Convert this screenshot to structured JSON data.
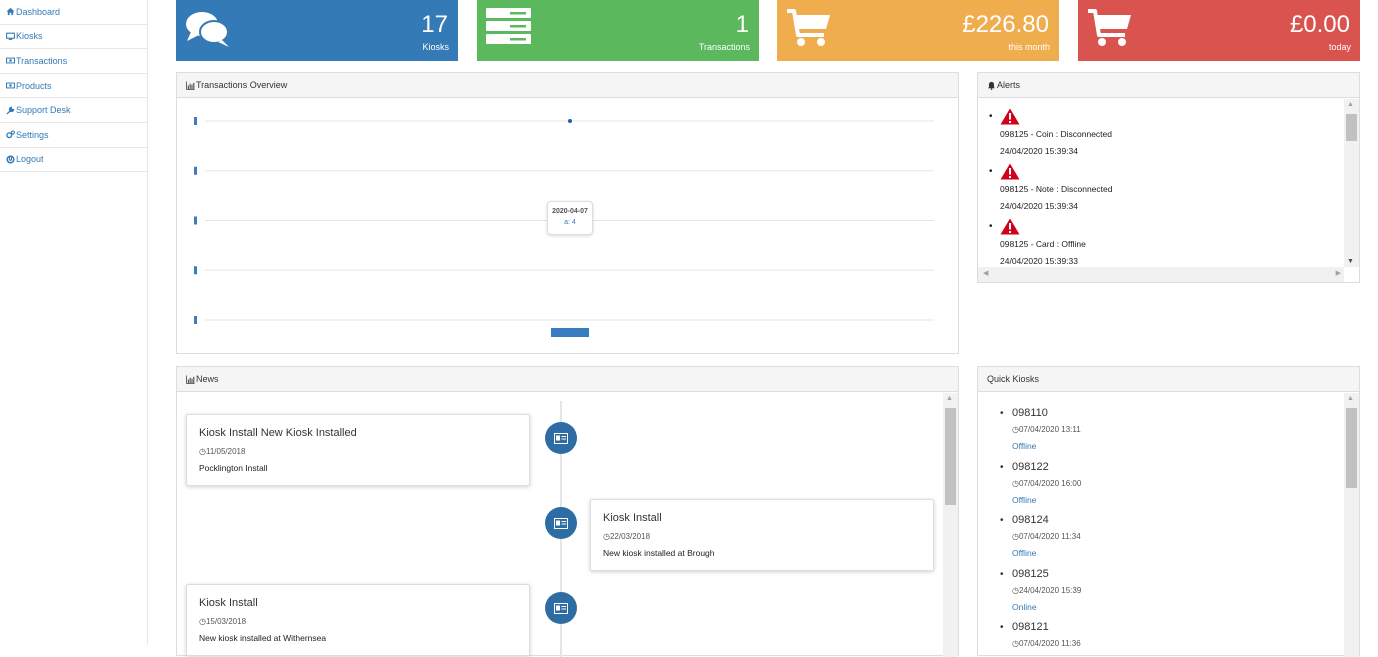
{
  "sidebar": {
    "items": [
      {
        "label": "Dashboard",
        "icon": "home-icon"
      },
      {
        "label": "Kiosks",
        "icon": "desktop-icon"
      },
      {
        "label": "Transactions",
        "icon": "money-icon"
      },
      {
        "label": "Products",
        "icon": "money-icon"
      },
      {
        "label": "Support Desk",
        "icon": "wrench-icon"
      },
      {
        "label": "Settings",
        "icon": "gears-icon"
      },
      {
        "label": "Logout",
        "icon": "power-icon"
      }
    ]
  },
  "stats": [
    {
      "value": "17",
      "label": "Kiosks",
      "color": "#337ab7",
      "icon": "comments-icon"
    },
    {
      "value": "1",
      "label": "Transactions",
      "color": "#5cb85c",
      "icon": "server-icon"
    },
    {
      "value": "£226.80",
      "label": "this month",
      "color": "#f0ad4e",
      "icon": "cart-icon"
    },
    {
      "value": "£0.00",
      "label": "today",
      "color": "#d9534f",
      "icon": "cart-icon"
    }
  ],
  "transactions_panel": {
    "title": "Transactions Overview",
    "tooltip_date": "2020-04-07",
    "tooltip_value": "a: 4"
  },
  "chart_data": {
    "type": "bar",
    "categories": [
      "2020-04-07"
    ],
    "series": [
      {
        "values": [
          4
        ]
      }
    ],
    "grid": true
  },
  "alerts_panel": {
    "title": "Alerts",
    "items": [
      {
        "message": "098125 - Coin : Disconnected",
        "time": "24/04/2020 15:39:34"
      },
      {
        "message": "098125 - Note : Disconnected",
        "time": "24/04/2020 15:39:34"
      },
      {
        "message": "098125 - Card : Offline",
        "time": "24/04/2020 15:39:33"
      }
    ]
  },
  "news_panel": {
    "title": "News",
    "items": [
      {
        "title": "Kiosk Install New Kiosk Installed",
        "date": "11/05/2018",
        "body": "Pocklington Install"
      },
      {
        "title": "Kiosk Install",
        "date": "22/03/2018",
        "body": "New kiosk installed at Brough"
      },
      {
        "title": "Kiosk Install",
        "date": "15/03/2018",
        "body": "New kiosk installed at Withernsea"
      }
    ]
  },
  "quick_kiosks_panel": {
    "title": "Quick Kiosks",
    "items": [
      {
        "id": "098110",
        "date": "07/04/2020 13:11",
        "status": "Offline"
      },
      {
        "id": "098122",
        "date": "07/04/2020 16:00",
        "status": "Offline"
      },
      {
        "id": "098124",
        "date": "07/04/2020 11:34",
        "status": "Offline"
      },
      {
        "id": "098125",
        "date": "24/04/2020 15:39",
        "status": "Online"
      },
      {
        "id": "098121",
        "date": "07/04/2020 11:36",
        "status": ""
      }
    ]
  }
}
